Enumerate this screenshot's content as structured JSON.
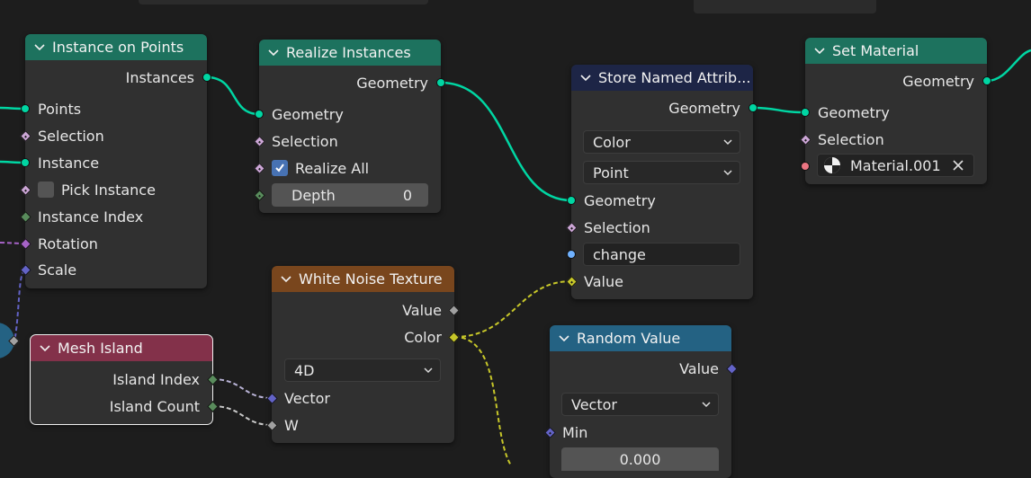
{
  "colors": {
    "geometry_socket": "#00d6a3",
    "field_socket": "#cca6d6",
    "int_socket": "#598c5c",
    "vector_socket": "#6363c7",
    "rotation_socket": "#a663c7",
    "color_socket": "#c7c729",
    "float_socket": "#a1a1a1",
    "string_socket": "#70b2ff",
    "material_socket": "#eb7582"
  },
  "nodes": {
    "instance_on_points": {
      "title": "Instance on Points",
      "outputs": [
        "Instances"
      ],
      "inputs": [
        "Points",
        "Selection",
        "Instance",
        "Pick Instance",
        "Instance Index",
        "Rotation",
        "Scale"
      ],
      "pick_instance_checked": false
    },
    "realize_instances": {
      "title": "Realize Instances",
      "outputs": [
        "Geometry"
      ],
      "inputs": [
        "Geometry",
        "Selection",
        "Realize All",
        "Depth"
      ],
      "realize_all_checked": true,
      "depth_value": "0"
    },
    "store_named_attribute": {
      "title": "Store Named Attrib...",
      "outputs": [
        "Geometry"
      ],
      "data_type": "Color",
      "domain": "Point",
      "inputs": [
        "Geometry",
        "Selection",
        "Value"
      ],
      "name_value": "change"
    },
    "set_material": {
      "title": "Set Material",
      "outputs": [
        "Geometry"
      ],
      "inputs": [
        "Geometry",
        "Selection"
      ],
      "material_value": "Material.001"
    },
    "white_noise_texture": {
      "title": "White Noise Texture",
      "outputs": [
        "Value",
        "Color"
      ],
      "dimensions": "4D",
      "inputs": [
        "Vector",
        "W"
      ]
    },
    "mesh_island": {
      "title": "Mesh Island",
      "outputs": [
        "Island Index",
        "Island Count"
      ]
    },
    "random_value": {
      "title": "Random Value",
      "outputs": [
        "Value"
      ],
      "data_type": "Vector",
      "inputs": [
        "Min"
      ],
      "min_value": "0.000"
    }
  }
}
